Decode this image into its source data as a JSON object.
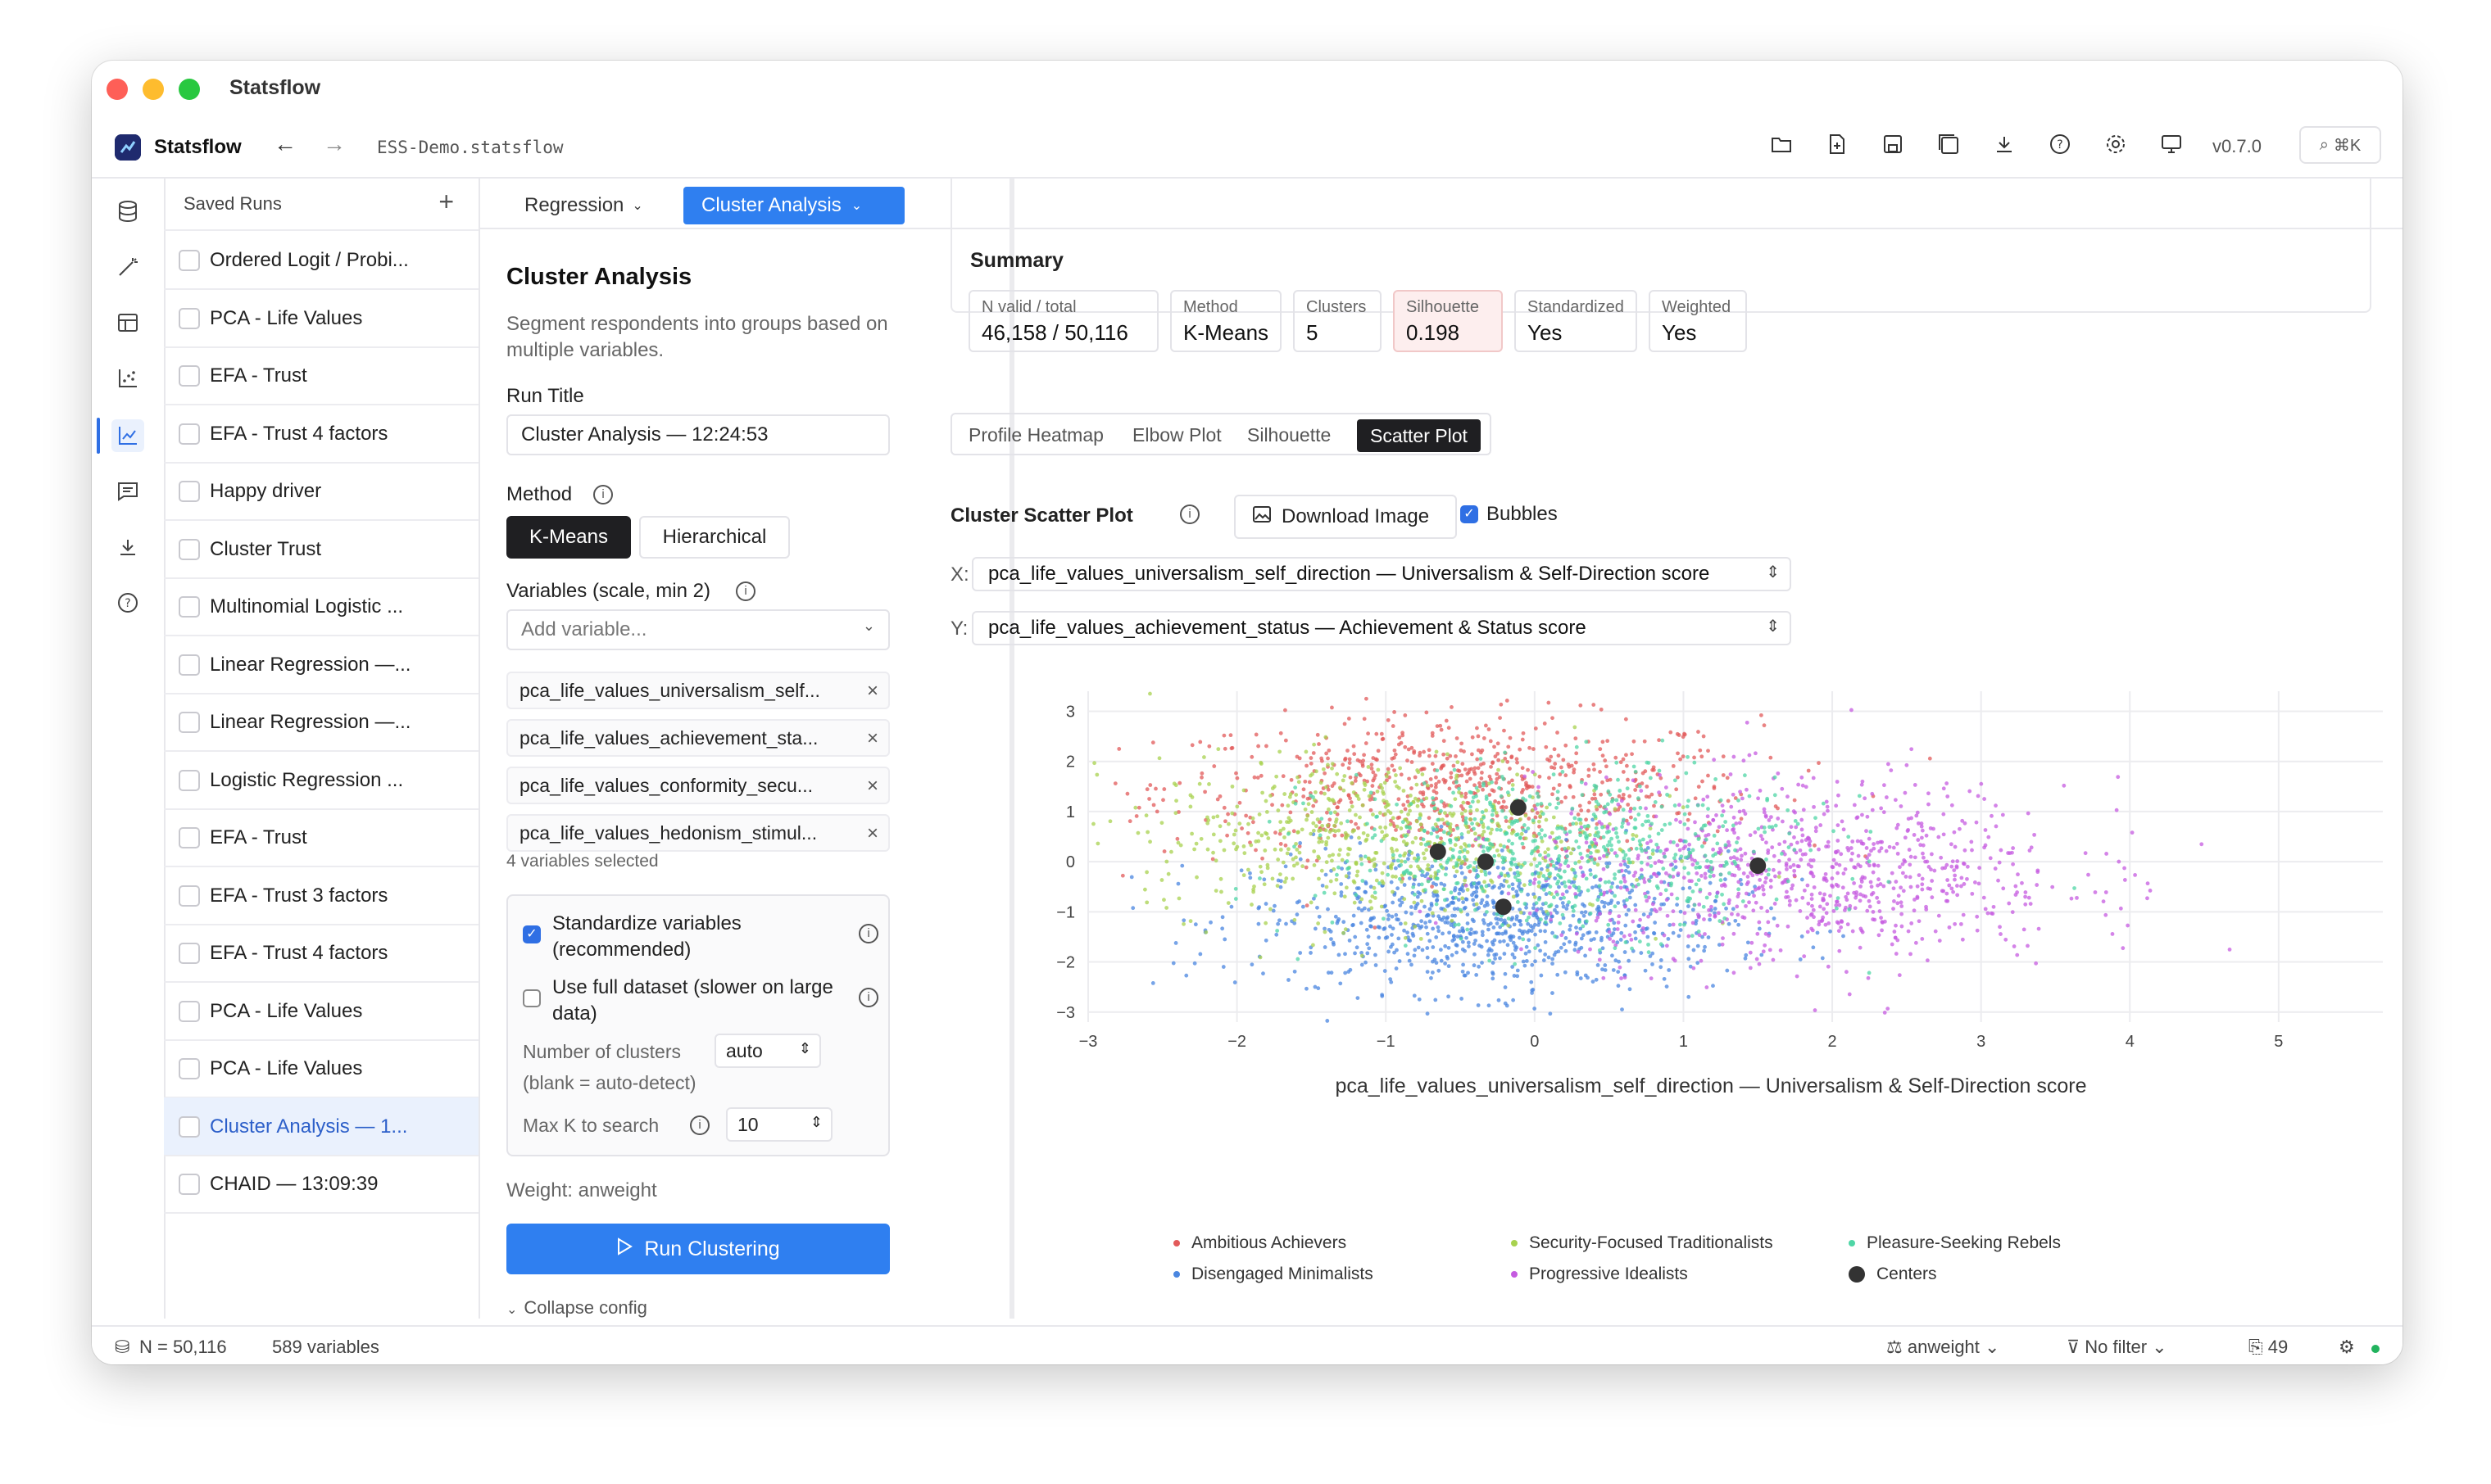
{
  "window": {
    "title": "Statsflow"
  },
  "app": {
    "name": "Statsflow",
    "file": "ESS-Demo.statsflow",
    "version": "v0.7.0",
    "search_shortcut": "⌘K",
    "toolbar_icons": [
      "open-folder-icon",
      "new-file-icon",
      "save-icon",
      "save-as-icon",
      "download-icon",
      "help-icon",
      "settings-icon",
      "display-icon"
    ]
  },
  "rail_icons": [
    "database-icon",
    "wand-icon",
    "table-icon",
    "scatter-icon",
    "line-chart-icon",
    "comment-icon",
    "import-icon",
    "help-icon"
  ],
  "runs": {
    "title": "Saved Runs",
    "add_label": "+",
    "items": [
      "Ordered Logit / Probi...",
      "PCA - Life Values",
      "EFA - Trust",
      "EFA - Trust 4 factors",
      "Happy driver",
      "Cluster Trust",
      "Multinomial Logistic ...",
      "Linear Regression —...",
      "Linear Regression —...",
      "Logistic Regression ...",
      "EFA - Trust",
      "EFA - Trust 3 factors",
      "EFA - Trust 4 factors",
      "PCA - Life Values",
      "PCA - Life Values",
      "Cluster Analysis — 1...",
      "CHAID — 13:09:39"
    ],
    "active_index": 15
  },
  "tabs": {
    "regression": "Regression",
    "cluster": "Cluster Analysis"
  },
  "config": {
    "title": "Cluster Analysis",
    "description": "Segment respondents into groups based on multiple variables.",
    "run_title_label": "Run Title",
    "run_title_value": "Cluster Analysis — 12:24:53",
    "method_label": "Method",
    "methods": [
      "K-Means",
      "Hierarchical"
    ],
    "selected_method": "K-Means",
    "variables_label": "Variables (scale, min 2)",
    "add_variable_placeholder": "Add variable...",
    "variables": [
      "pca_life_values_universalism_self...",
      "pca_life_values_achievement_sta...",
      "pca_life_values_conformity_secu...",
      "pca_life_values_hedonism_stimul..."
    ],
    "variables_count": "4 variables selected",
    "standardize_label": "Standardize variables (recommended)",
    "standardize_checked": true,
    "full_dataset_label": "Use full dataset (slower on large data)",
    "full_dataset_checked": false,
    "num_clusters_label": "Number of clusters",
    "num_clusters_value": "auto",
    "num_clusters_hint": "(blank = auto-detect)",
    "max_k_label": "Max K to search",
    "max_k_value": "10",
    "weight": "Weight: anweight",
    "run_button": "Run Clustering",
    "collapse": "Collapse config"
  },
  "summary": {
    "title": "Summary",
    "stats": [
      {
        "key": "N valid / total",
        "value": "46,158 / 50,116"
      },
      {
        "key": "Method",
        "value": "K-Means"
      },
      {
        "key": "Clusters",
        "value": "5"
      },
      {
        "key": "Silhouette",
        "value": "0.198"
      },
      {
        "key": "Standardized",
        "value": "Yes"
      },
      {
        "key": "Weighted",
        "value": "Yes"
      }
    ]
  },
  "viz_tabs": [
    "Profile Heatmap",
    "Elbow Plot",
    "Silhouette",
    "Scatter Plot"
  ],
  "viz_selected": "Scatter Plot",
  "scatter": {
    "title": "Cluster Scatter Plot",
    "download": "Download Image",
    "bubbles_label": "Bubbles",
    "bubbles_checked": true,
    "x_label": "X:",
    "y_label": "Y:",
    "x_select": "pca_life_values_universalism_self_direction — Universalism & Self-Direction score",
    "y_select": "pca_life_values_achievement_status — Achievement & Status score"
  },
  "chart_data": {
    "type": "scatter",
    "xlabel": "pca_life_values_universalism_self_direction — Universalism & Self-Direction score",
    "ylabel": "pca_life_values_achievement_status — Achievement & Sta",
    "xlim": [
      -3,
      5.7
    ],
    "ylim": [
      -3.2,
      3.4
    ],
    "x_ticks": [
      -3,
      -2,
      -1,
      0,
      1,
      2,
      3,
      4,
      5
    ],
    "y_ticks": [
      -3,
      -2,
      -1,
      0,
      1,
      2,
      3
    ],
    "grid": true,
    "legend_placement": "bottom",
    "series": [
      {
        "name": "Ambitious Achievers",
        "color": "#e25a5a",
        "center": [
          -0.5,
          1.5
        ],
        "spread": [
          1.0,
          0.7
        ],
        "n": 700
      },
      {
        "name": "Disengaged Minimalists",
        "color": "#4a86e0",
        "center": [
          -0.3,
          -1.2
        ],
        "spread": [
          0.8,
          0.7
        ],
        "n": 900
      },
      {
        "name": "Security-Focused Traditionalists",
        "color": "#a8d24f",
        "center": [
          -1.0,
          0.5
        ],
        "spread": [
          0.8,
          0.8
        ],
        "n": 650
      },
      {
        "name": "Progressive Idealists",
        "color": "#c55be0",
        "center": [
          1.8,
          -0.2
        ],
        "spread": [
          0.9,
          0.9
        ],
        "n": 900
      },
      {
        "name": "Pleasure-Seeking Rebels",
        "color": "#4fd6a6",
        "center": [
          0.2,
          0.2
        ],
        "spread": [
          0.8,
          0.8
        ],
        "n": 650
      }
    ],
    "centers": {
      "name": "Centers",
      "color": "#333333",
      "points": [
        [
          -0.11,
          1.08
        ],
        [
          -0.65,
          0.2
        ],
        [
          -0.33,
          0.0
        ],
        [
          -0.21,
          -0.9
        ],
        [
          1.5,
          -0.08
        ]
      ]
    }
  },
  "statusbar": {
    "n": "N = 50,116",
    "variables": "589 variables",
    "weight": "anweight",
    "filter": "No filter",
    "count": "49"
  }
}
